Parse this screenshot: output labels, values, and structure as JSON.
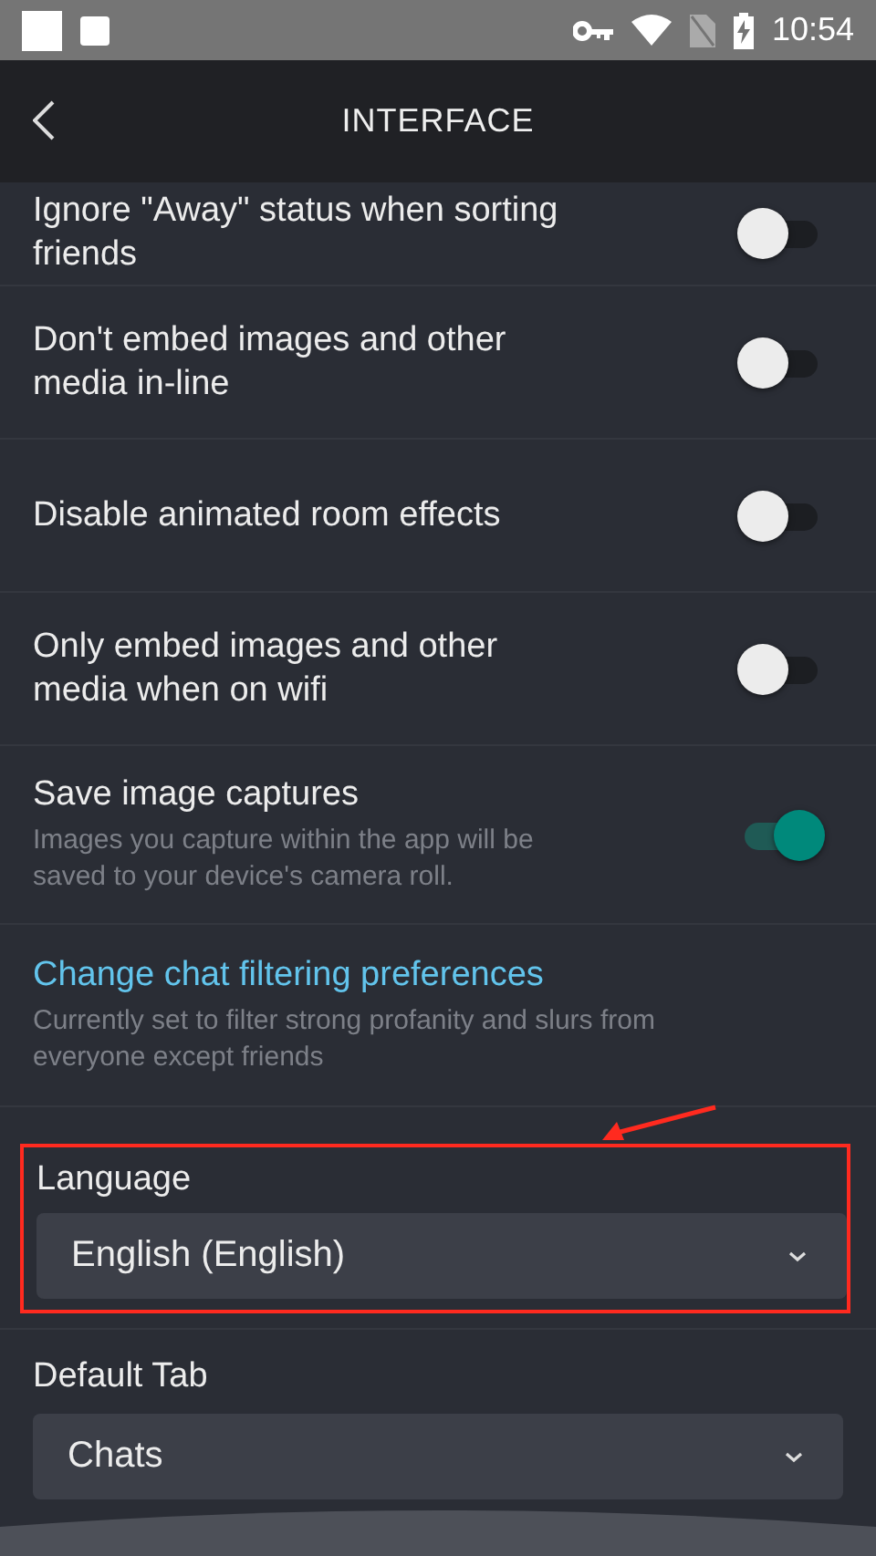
{
  "status_bar": {
    "time": "10:54"
  },
  "header": {
    "title": "INTERFACE"
  },
  "settings": [
    {
      "kind": "toggle",
      "label": "Ignore \"Away\" status when sorting friends",
      "on": false
    },
    {
      "kind": "toggle",
      "label": "Don't embed images and other media in-line",
      "on": false
    },
    {
      "kind": "toggle",
      "label": "Disable animated room effects",
      "on": false
    },
    {
      "kind": "toggle",
      "label": "Only embed images and other media when on wifi",
      "on": false
    },
    {
      "kind": "toggle",
      "label": "Save image captures",
      "description": "Images you capture within the app will be saved to your device's camera roll.",
      "on": true
    },
    {
      "kind": "link",
      "label": "Change chat filtering preferences",
      "description": "Currently set to filter strong profanity and slurs from everyone except friends"
    }
  ],
  "dropdowns": [
    {
      "label": "Language",
      "value": "English (English)",
      "highlighted": true
    },
    {
      "label": "Default Tab",
      "value": "Chats",
      "highlighted": false
    }
  ]
}
